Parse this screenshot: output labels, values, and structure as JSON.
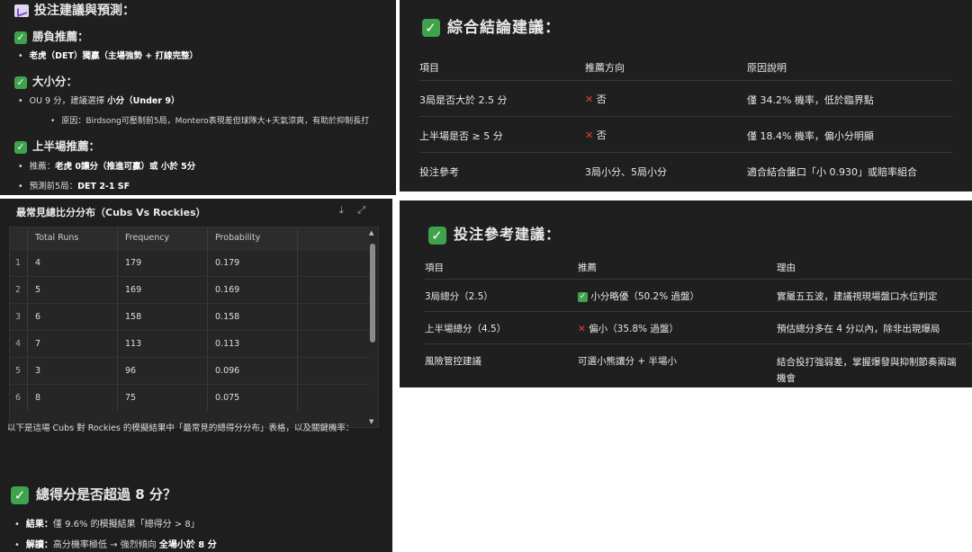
{
  "top_left": {
    "title": "投注建議與預測：",
    "sections": [
      {
        "heading": "勝負推薦：",
        "bullets": [
          {
            "text": "老虎（DET）獨贏（主場強勢 + 打線完整）",
            "bold": true
          }
        ]
      },
      {
        "heading": "大小分：",
        "bullets": [
          {
            "text": "OU 9 分，建議選擇 ",
            "bold_part": "小分（Under 9）"
          },
          {
            "text": "原因：Birdsong可壓制前5局，Montero表現差但球隊大+天氣涼爽，有助於抑制長打",
            "indent": true
          }
        ]
      },
      {
        "heading": "上半場推薦：",
        "bullets": [
          {
            "text": "推薦：",
            "bold_part": "老虎 0讓分（推進可贏）或 小於 5分"
          },
          {
            "text": "預測前5局：",
            "bold_part": "DET 2-1 SF"
          }
        ]
      }
    ]
  },
  "top_right": {
    "title": "綜合結論建議：",
    "headers": [
      "項目",
      "推薦方向",
      "原因說明"
    ],
    "rows": [
      {
        "item": "3局是否大於 2.5 分",
        "rec_icon": "cross",
        "rec": "否",
        "reason": "僅 34.2% 機率，低於臨界點"
      },
      {
        "item": "上半場是否 ≥ 5 分",
        "rec_icon": "cross",
        "rec": "否",
        "reason": "僅 18.4% 機率，偏小分明顯"
      },
      {
        "item": "投注參考",
        "rec_icon": "",
        "rec": "3局小分、5局小分",
        "reason": "適合結合盤口「小 0.930」或賠率組合"
      }
    ]
  },
  "middle_left": {
    "table_title": "最常見總比分分布（Cubs Vs Rockies）",
    "download_icon": "download-icon",
    "expand_icon": "expand-icon",
    "columns": [
      "Total Runs",
      "Frequency",
      "Probability"
    ],
    "rows": [
      {
        "idx": "1",
        "runs": "4",
        "freq": "179",
        "prob": "0.179"
      },
      {
        "idx": "2",
        "runs": "5",
        "freq": "169",
        "prob": "0.169"
      },
      {
        "idx": "3",
        "runs": "6",
        "freq": "158",
        "prob": "0.158"
      },
      {
        "idx": "4",
        "runs": "7",
        "freq": "113",
        "prob": "0.113"
      },
      {
        "idx": "5",
        "runs": "3",
        "freq": "96",
        "prob": "0.096"
      },
      {
        "idx": "6",
        "runs": "8",
        "freq": "75",
        "prob": "0.075"
      }
    ],
    "note": "以下是這場 Cubs 對 Rockies 的模擬結果中「最常見的總得分分布」表格，以及關鍵機率：",
    "heading": "總得分是否超過 8 分？",
    "bullets": [
      {
        "label": "結果：",
        "text": "僅 9.6% 的模擬結果「總得分 > 8」"
      },
      {
        "label": "解讀：",
        "text": "高分機率極低 → 強烈傾向 ",
        "bold_part": "全場小於 8 分"
      }
    ]
  },
  "middle_right": {
    "title": "投注參考建議：",
    "headers": [
      "項目",
      "推薦",
      "理由"
    ],
    "rows": [
      {
        "item": "3局總分（2.5）",
        "rec_icon": "check",
        "rec": "小分略優（50.2% 過盤）",
        "reason": "實屬五五波，建議視現場盤口水位判定"
      },
      {
        "item": "上半場總分（4.5）",
        "rec_icon": "cross",
        "rec": "偏小（35.8% 過盤）",
        "reason": "預估總分多在 4 分以內，除非出現爆局"
      },
      {
        "item": "風險管控建議",
        "rec_icon": "",
        "rec": "可選小熊讓分 + 半場小",
        "reason": "結合投打強弱差，掌握爆發與抑制節奏兩端機會"
      }
    ]
  },
  "colors": {
    "panel_bg": "#1f1f1f",
    "check_green": "#3fa34d",
    "cross_red": "#e0413f"
  }
}
